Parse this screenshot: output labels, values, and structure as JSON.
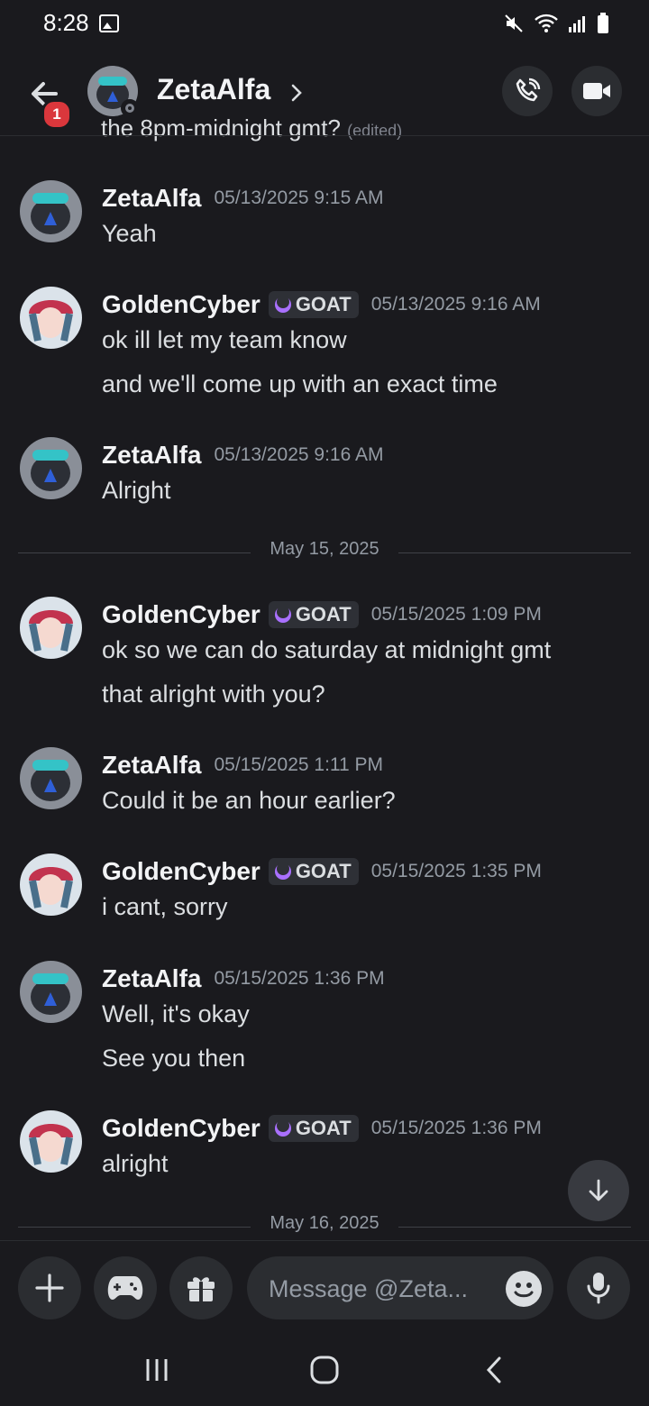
{
  "status_bar": {
    "time": "8:28",
    "icons": [
      "gallery-icon",
      "mute-icon",
      "wifi-icon",
      "signal-icon",
      "battery-icon"
    ]
  },
  "header": {
    "title": "ZetaAlfa",
    "notification_count": "1",
    "icons": [
      "back-arrow-icon",
      "chevron-right-icon",
      "phone-icon",
      "video-icon"
    ]
  },
  "partial_message": {
    "text": "the 8pm-midnight gmt?",
    "edited": "(edited)"
  },
  "messages": [
    {
      "author": "ZetaAlfa",
      "timestamp": "05/13/2025 9:15 AM",
      "lines": [
        "Yeah"
      ]
    },
    {
      "author": "GoldenCyber",
      "tag": "GOAT",
      "timestamp": "05/13/2025 9:16 AM",
      "lines": [
        "ok ill let my team know",
        "and we'll come up with an exact time"
      ]
    },
    {
      "author": "ZetaAlfa",
      "timestamp": "05/13/2025 9:16 AM",
      "lines": [
        "Alright"
      ]
    },
    {
      "author": "GoldenCyber",
      "tag": "GOAT",
      "timestamp": "05/15/2025 1:09 PM",
      "lines": [
        "ok so we can do saturday at midnight gmt",
        "that alright with you?"
      ]
    },
    {
      "author": "ZetaAlfa",
      "timestamp": "05/15/2025 1:11 PM",
      "lines": [
        "Could it be an hour earlier?"
      ]
    },
    {
      "author": "GoldenCyber",
      "tag": "GOAT",
      "timestamp": "05/15/2025 1:35 PM",
      "lines": [
        "i cant, sorry"
      ]
    },
    {
      "author": "ZetaAlfa",
      "timestamp": "05/15/2025 1:36 PM",
      "lines": [
        "Well, it's okay",
        "See you then"
      ]
    },
    {
      "author": "GoldenCyber",
      "tag": "GOAT",
      "timestamp": "05/15/2025 1:36 PM",
      "lines": [
        "alright"
      ]
    }
  ],
  "dividers": [
    "May 15, 2025",
    "May 16, 2025"
  ],
  "composer": {
    "placeholder": "Message @Zeta...",
    "icons": [
      "plus-icon",
      "gamepad-icon",
      "gift-icon",
      "emoji-icon",
      "microphone-icon"
    ]
  },
  "colors": {
    "background": "#1a1a1e",
    "surface": "#2b2d31",
    "text": "#dbdee1",
    "muted": "#949ba4",
    "badge_red": "#da373c",
    "tag_purple": "#a970ff"
  }
}
